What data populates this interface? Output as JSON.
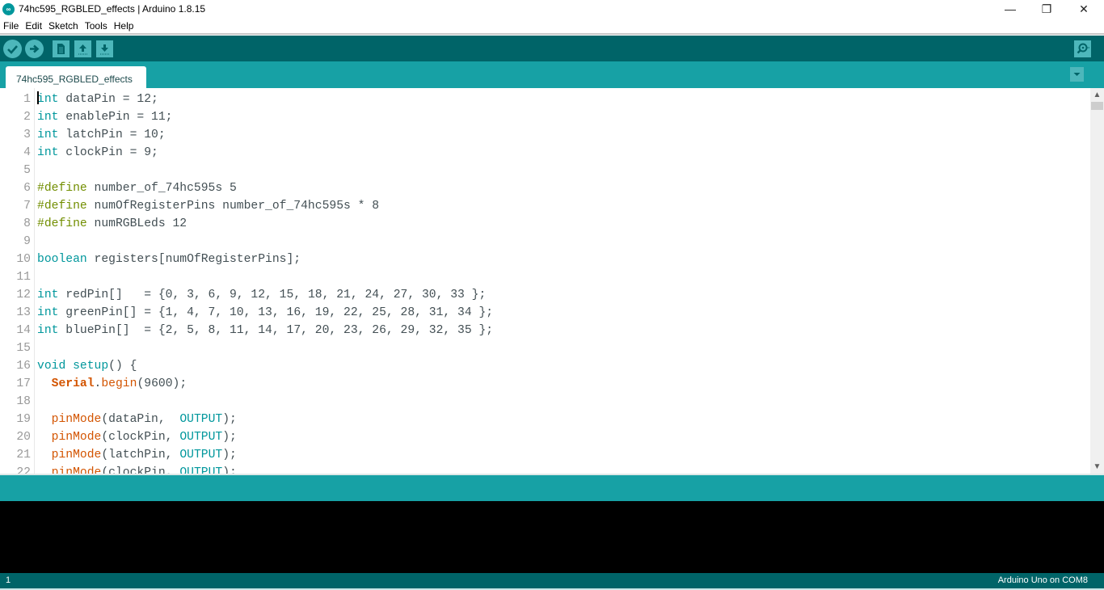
{
  "window": {
    "title": "74hc595_RGBLED_effects | Arduino 1.8.15",
    "app_icon": "arduino-logo-icon",
    "controls": {
      "minimize": "—",
      "maximize": "❐",
      "close": "✕"
    }
  },
  "menu": {
    "items": [
      {
        "label": "File"
      },
      {
        "label": "Edit"
      },
      {
        "label": "Sketch"
      },
      {
        "label": "Tools"
      },
      {
        "label": "Help"
      }
    ]
  },
  "toolbar": {
    "buttons": [
      {
        "name": "verify",
        "icon": "checkmark-icon"
      },
      {
        "name": "upload",
        "icon": "arrow-right-icon"
      },
      {
        "name": "new",
        "icon": "document-icon"
      },
      {
        "name": "open",
        "icon": "arrow-up-icon"
      },
      {
        "name": "save",
        "icon": "arrow-down-icon"
      }
    ],
    "serial_monitor_icon": "magnifier-icon"
  },
  "tabs": [
    {
      "label": "74hc595_RGBLED_effects",
      "active": true
    }
  ],
  "editor": {
    "lines": [
      {
        "n": "1",
        "html": "<span class=\"kw\">int</span> dataPin = 12;"
      },
      {
        "n": "2",
        "html": "<span class=\"kw\">int</span> enablePin = 11;"
      },
      {
        "n": "3",
        "html": "<span class=\"kw\">int</span> latchPin = 10;"
      },
      {
        "n": "4",
        "html": "<span class=\"kw\">int</span> clockPin = 9;"
      },
      {
        "n": "5",
        "html": ""
      },
      {
        "n": "6",
        "html": "<span class=\"pp\">#define</span> number_of_74hc595s 5"
      },
      {
        "n": "7",
        "html": "<span class=\"pp\">#define</span> numOfRegisterPins number_of_74hc595s * 8"
      },
      {
        "n": "8",
        "html": "<span class=\"pp\">#define</span> numRGBLeds 12"
      },
      {
        "n": "9",
        "html": ""
      },
      {
        "n": "10",
        "html": "<span class=\"kw\">boolean</span> registers[numOfRegisterPins];"
      },
      {
        "n": "11",
        "html": ""
      },
      {
        "n": "12",
        "html": "<span class=\"kw\">int</span> redPin[]   = {0, 3, 6, 9, 12, 15, 18, 21, 24, 27, 30, 33 };"
      },
      {
        "n": "13",
        "html": "<span class=\"kw\">int</span> greenPin[] = {1, 4, 7, 10, 13, 16, 19, 22, 25, 28, 31, 34 };"
      },
      {
        "n": "14",
        "html": "<span class=\"kw\">int</span> bluePin[]  = {2, 5, 8, 11, 14, 17, 20, 23, 26, 29, 32, 35 };"
      },
      {
        "n": "15",
        "html": ""
      },
      {
        "n": "16",
        "html": "<span class=\"kw\">void</span> <span class=\"kw\">setup</span>() {"
      },
      {
        "n": "17",
        "html": "  <span class=\"cls\">Serial</span>.<span class=\"fn\">begin</span>(9600);"
      },
      {
        "n": "18",
        "html": ""
      },
      {
        "n": "19",
        "html": "  <span class=\"fn\">pinMode</span>(dataPin,  <span class=\"cst\">OUTPUT</span>);"
      },
      {
        "n": "20",
        "html": "  <span class=\"fn\">pinMode</span>(clockPin, <span class=\"cst\">OUTPUT</span>);"
      },
      {
        "n": "21",
        "html": "  <span class=\"fn\">pinMode</span>(latchPin, <span class=\"cst\">OUTPUT</span>);"
      },
      {
        "n": "22",
        "html": "  <span class=\"fn\">pinMode</span>(clockPin, <span class=\"cst\">OUTPUT</span>);"
      }
    ]
  },
  "status": {
    "line_number": "1",
    "board": "Arduino Uno on COM8"
  },
  "colors": {
    "toolbar": "#006468",
    "tabbar": "#17a1a5",
    "button": "#4db7bb",
    "keyword": "#00979c",
    "preprocessor": "#728e00",
    "function": "#d35400"
  }
}
